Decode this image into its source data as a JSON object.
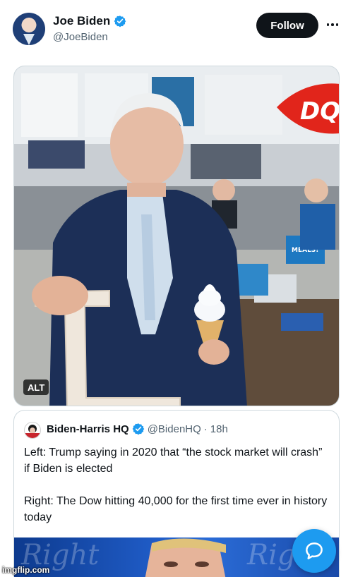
{
  "post": {
    "author_name": "Joe Biden",
    "author_handle": "@JoeBiden",
    "follow_label": "Follow",
    "alt_label": "ALT",
    "media_signage": {
      "store_logo": "DQ",
      "menu_sign": "MEALS!"
    }
  },
  "quote": {
    "author_name": "Biden-Harris HQ",
    "author_handle": "@BidenHQ",
    "separator": "·",
    "timestamp": "18h",
    "paragraphs": [
      "Left: Trump saying in 2020 that “the stock market will crash” if Biden is elected",
      "Right: The Dow hitting 40,000 for the first time ever in history today"
    ],
    "media_script_left": "Right",
    "media_script_right": "Rig"
  },
  "watermark": "imgflip.com",
  "colors": {
    "verified": "#1d9bf0",
    "follow_bg": "#0f1419",
    "chat_button": "#1d9bf0",
    "secondary_text": "#536471",
    "dq_red": "#e1251b"
  },
  "icons": [
    "verified-badge-icon",
    "more-options-icon",
    "chat-bubble-icon"
  ]
}
